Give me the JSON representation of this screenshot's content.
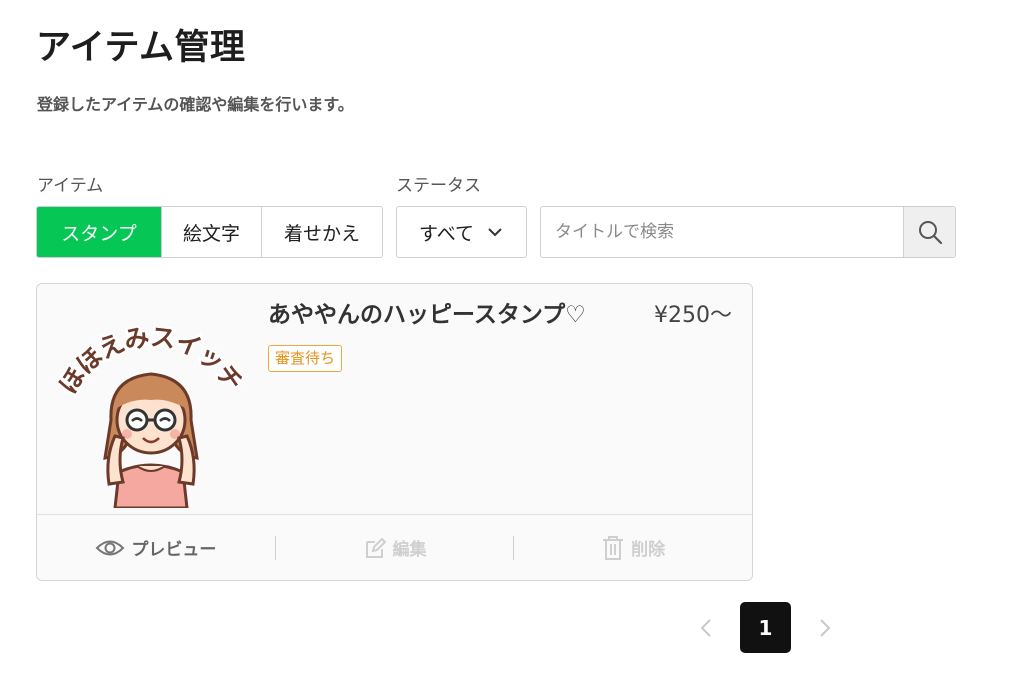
{
  "header": {
    "title": "アイテム管理",
    "subtitle": "登録したアイテムの確認や編集を行います。"
  },
  "filters": {
    "item_label": "アイテム",
    "item_types": [
      "スタンプ",
      "絵文字",
      "着せかえ"
    ],
    "active_item_type": "スタンプ",
    "status_label": "ステータス",
    "status_value": "すべて",
    "search_placeholder": "タイトルで検索",
    "search_value": ""
  },
  "items": [
    {
      "title": "あややんのハッピースタンプ♡",
      "price": "¥250〜",
      "status": "審査待ち",
      "thumbnail_text": "ほほえみスイッチ"
    }
  ],
  "actions": {
    "preview": "プレビュー",
    "edit": "編集",
    "delete": "削除"
  },
  "pagination": {
    "current": "1"
  },
  "colors": {
    "accent": "#06c755",
    "badge": "#f0a73c"
  },
  "icons": [
    "search-icon",
    "chevron-down-icon",
    "eye-icon",
    "edit-icon",
    "trash-icon",
    "chevron-left-icon",
    "chevron-right-icon"
  ]
}
